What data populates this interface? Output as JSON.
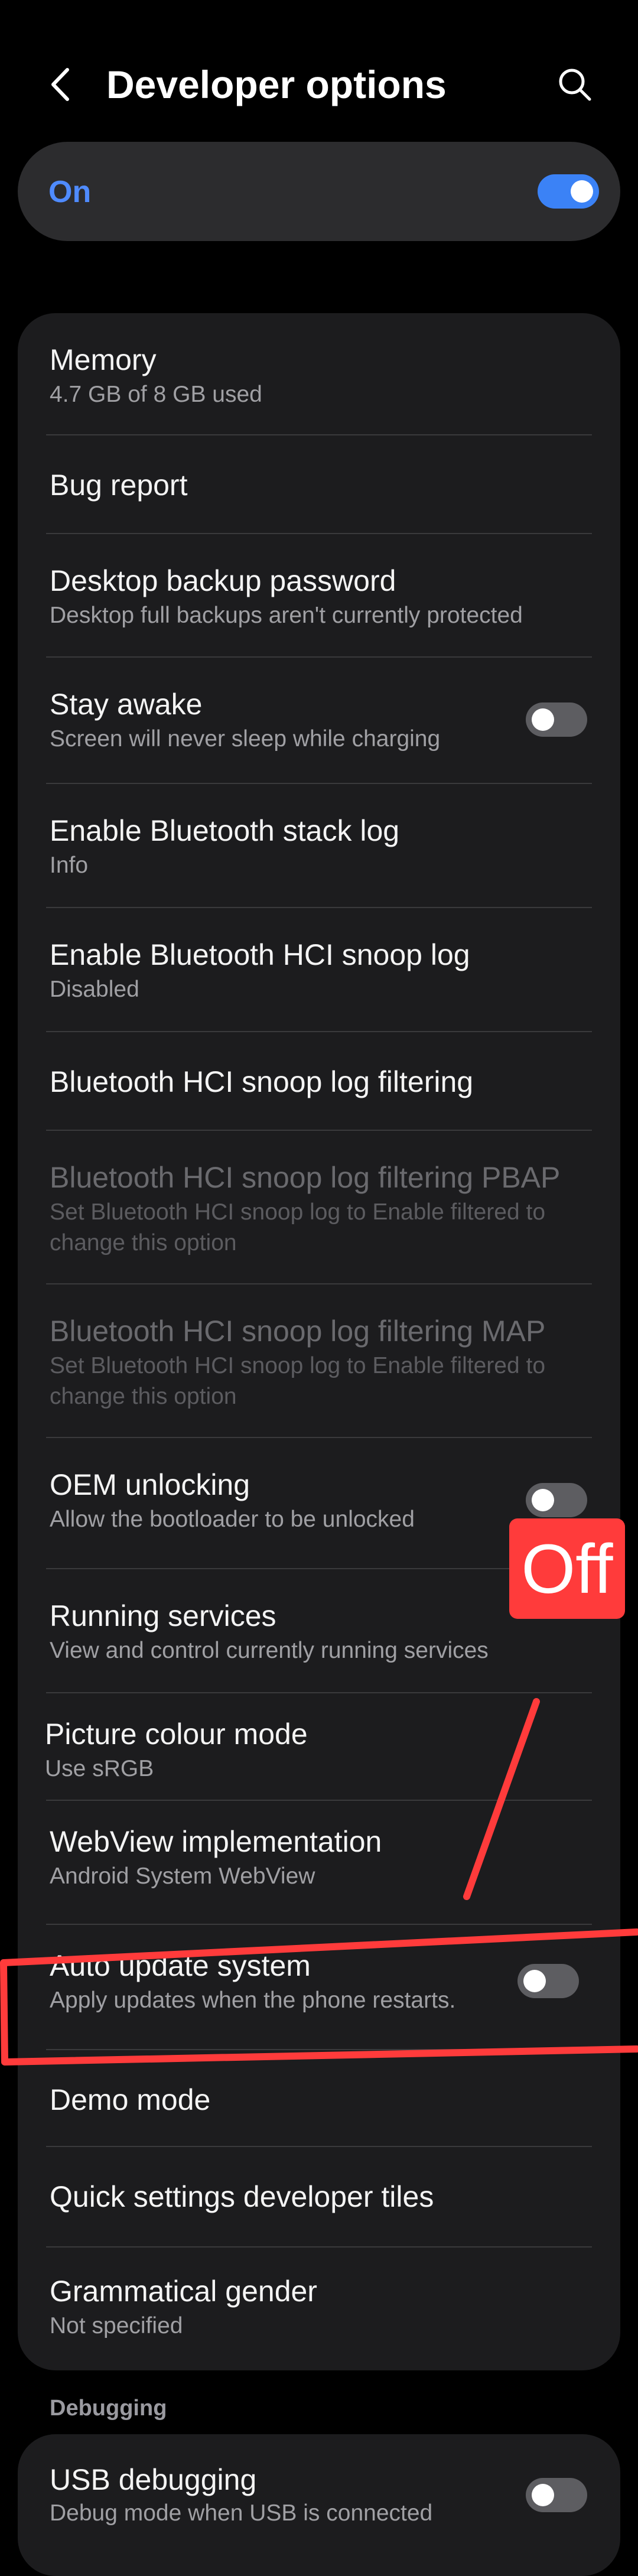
{
  "header": {
    "title": "Developer options",
    "back_icon": "back-chevron-icon",
    "search_icon": "search-icon"
  },
  "master_switch": {
    "label": "On",
    "state": "on",
    "accent_color": "#4f8bff"
  },
  "settings": [
    {
      "title": "Memory",
      "subtitle": "4.7 GB of 8 GB used"
    },
    {
      "title": "Bug report"
    },
    {
      "title": "Desktop backup password",
      "subtitle": "Desktop full backups aren't currently protected"
    },
    {
      "title": "Stay awake",
      "subtitle": "Screen will never sleep while charging",
      "toggle": "off"
    },
    {
      "title": "Enable Bluetooth stack log",
      "subtitle": "Info"
    },
    {
      "title": "Enable Bluetooth HCI snoop log",
      "subtitle": "Disabled"
    },
    {
      "title": "Bluetooth HCI snoop log filtering"
    },
    {
      "title": "Bluetooth HCI snoop log filtering PBAP",
      "subtitle": "Set Bluetooth HCI snoop log to Enable filtered to change this option",
      "disabled": true
    },
    {
      "title": "Bluetooth HCI snoop log filtering MAP",
      "subtitle": "Set Bluetooth HCI snoop log to Enable filtered to change this option",
      "disabled": true
    },
    {
      "title": "OEM unlocking",
      "subtitle": "Allow the bootloader to be unlocked",
      "toggle": "off"
    },
    {
      "title": "Running services",
      "subtitle": "View and control currently running services"
    },
    {
      "title": "Picture colour mode",
      "subtitle": "Use sRGB"
    },
    {
      "title": "WebView implementation",
      "subtitle": "Android System WebView"
    },
    {
      "title": "Auto update system",
      "subtitle": "Apply updates when the phone restarts.",
      "toggle": "off"
    },
    {
      "title": "Demo mode"
    },
    {
      "title": "Quick settings developer tiles"
    },
    {
      "title": "Grammatical gender",
      "subtitle": "Not specified"
    }
  ],
  "section": {
    "label": "Debugging"
  },
  "debugging": [
    {
      "title": "USB debugging",
      "subtitle": "Debug mode when USB is connected",
      "toggle": "off"
    }
  ],
  "annotation": {
    "label": "Off",
    "color": "#ff3b3b"
  }
}
